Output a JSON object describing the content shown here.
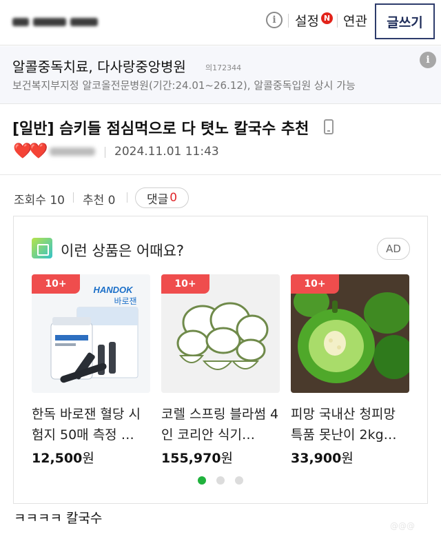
{
  "header": {
    "info_icon": "info-icon",
    "settings_label": "설정",
    "settings_badge": "N",
    "related_label": "연관",
    "write_label": "글쓰기"
  },
  "hospital_ad": {
    "title": "알콜중독치료, 다사랑중앙병원",
    "code": "의172344",
    "subtitle": "보건복지부지정 알코올전문병원(기간:24.01~26.12), 알콜중독입원 상시 가능",
    "info_icon": "info-icon"
  },
  "post": {
    "title": "[일반] 슴키들 점심먹으로 다 텻노 칼국수 추천",
    "device_icon": "mobile-phone-icon",
    "hearts": "❤️❤️",
    "date": "2024.11.01 11:43",
    "views_label": "조회수 10",
    "recommend_label": "추천 0",
    "comment_label": "댓글",
    "comment_count": "0",
    "body": "ㅋㅋㅋㅋ 칼국수"
  },
  "ad_box": {
    "heading": "이런 상품은 어때요?",
    "ad_tag": "AD",
    "products": [
      {
        "badge": "10+",
        "name": "한독 바로잰 혈당 시험지 50매 측정 …",
        "price": "12,500",
        "unit": "원",
        "brand_logo": "HANDOK",
        "brand_sub": "바로잰"
      },
      {
        "badge": "10+",
        "name": "코렐 스프링 블라썸 4인 코리안 식기…",
        "price": "155,970",
        "unit": "원"
      },
      {
        "badge": "10+",
        "name": "피망 국내산 청피망 특품 못난이 2kg…",
        "price": "33,900",
        "unit": "원"
      }
    ],
    "pagination": {
      "active": 0,
      "count": 3
    }
  },
  "colors": {
    "accent_red": "#ef4d4d",
    "write_border": "#2d3b6b",
    "active_dot": "#20b23d"
  }
}
